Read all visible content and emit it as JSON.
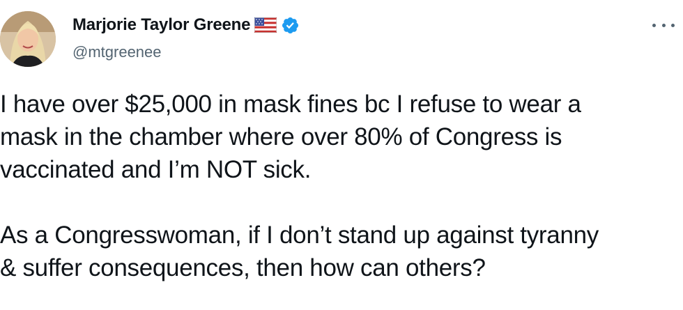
{
  "author": {
    "display_name": "Marjorie Taylor Greene",
    "handle": "@mtgreenee",
    "flag_icon": "us-flag-icon",
    "verified_icon": "verified-badge-icon",
    "verified_color": "#1d9bf0"
  },
  "menu": {
    "icon": "more-options-icon"
  },
  "tweet": {
    "paragraphs": [
      {
        "lines": [
          "I have over $25,000 in mask fines bc I refuse to wear a",
          "mask in the chamber where over 80% of Congress is",
          "vaccinated and I’m NOT sick."
        ]
      },
      {
        "lines": [
          "As a Congresswoman, if I don’t stand up against tyranny",
          "& suffer consequences, then how can others?"
        ]
      }
    ]
  }
}
